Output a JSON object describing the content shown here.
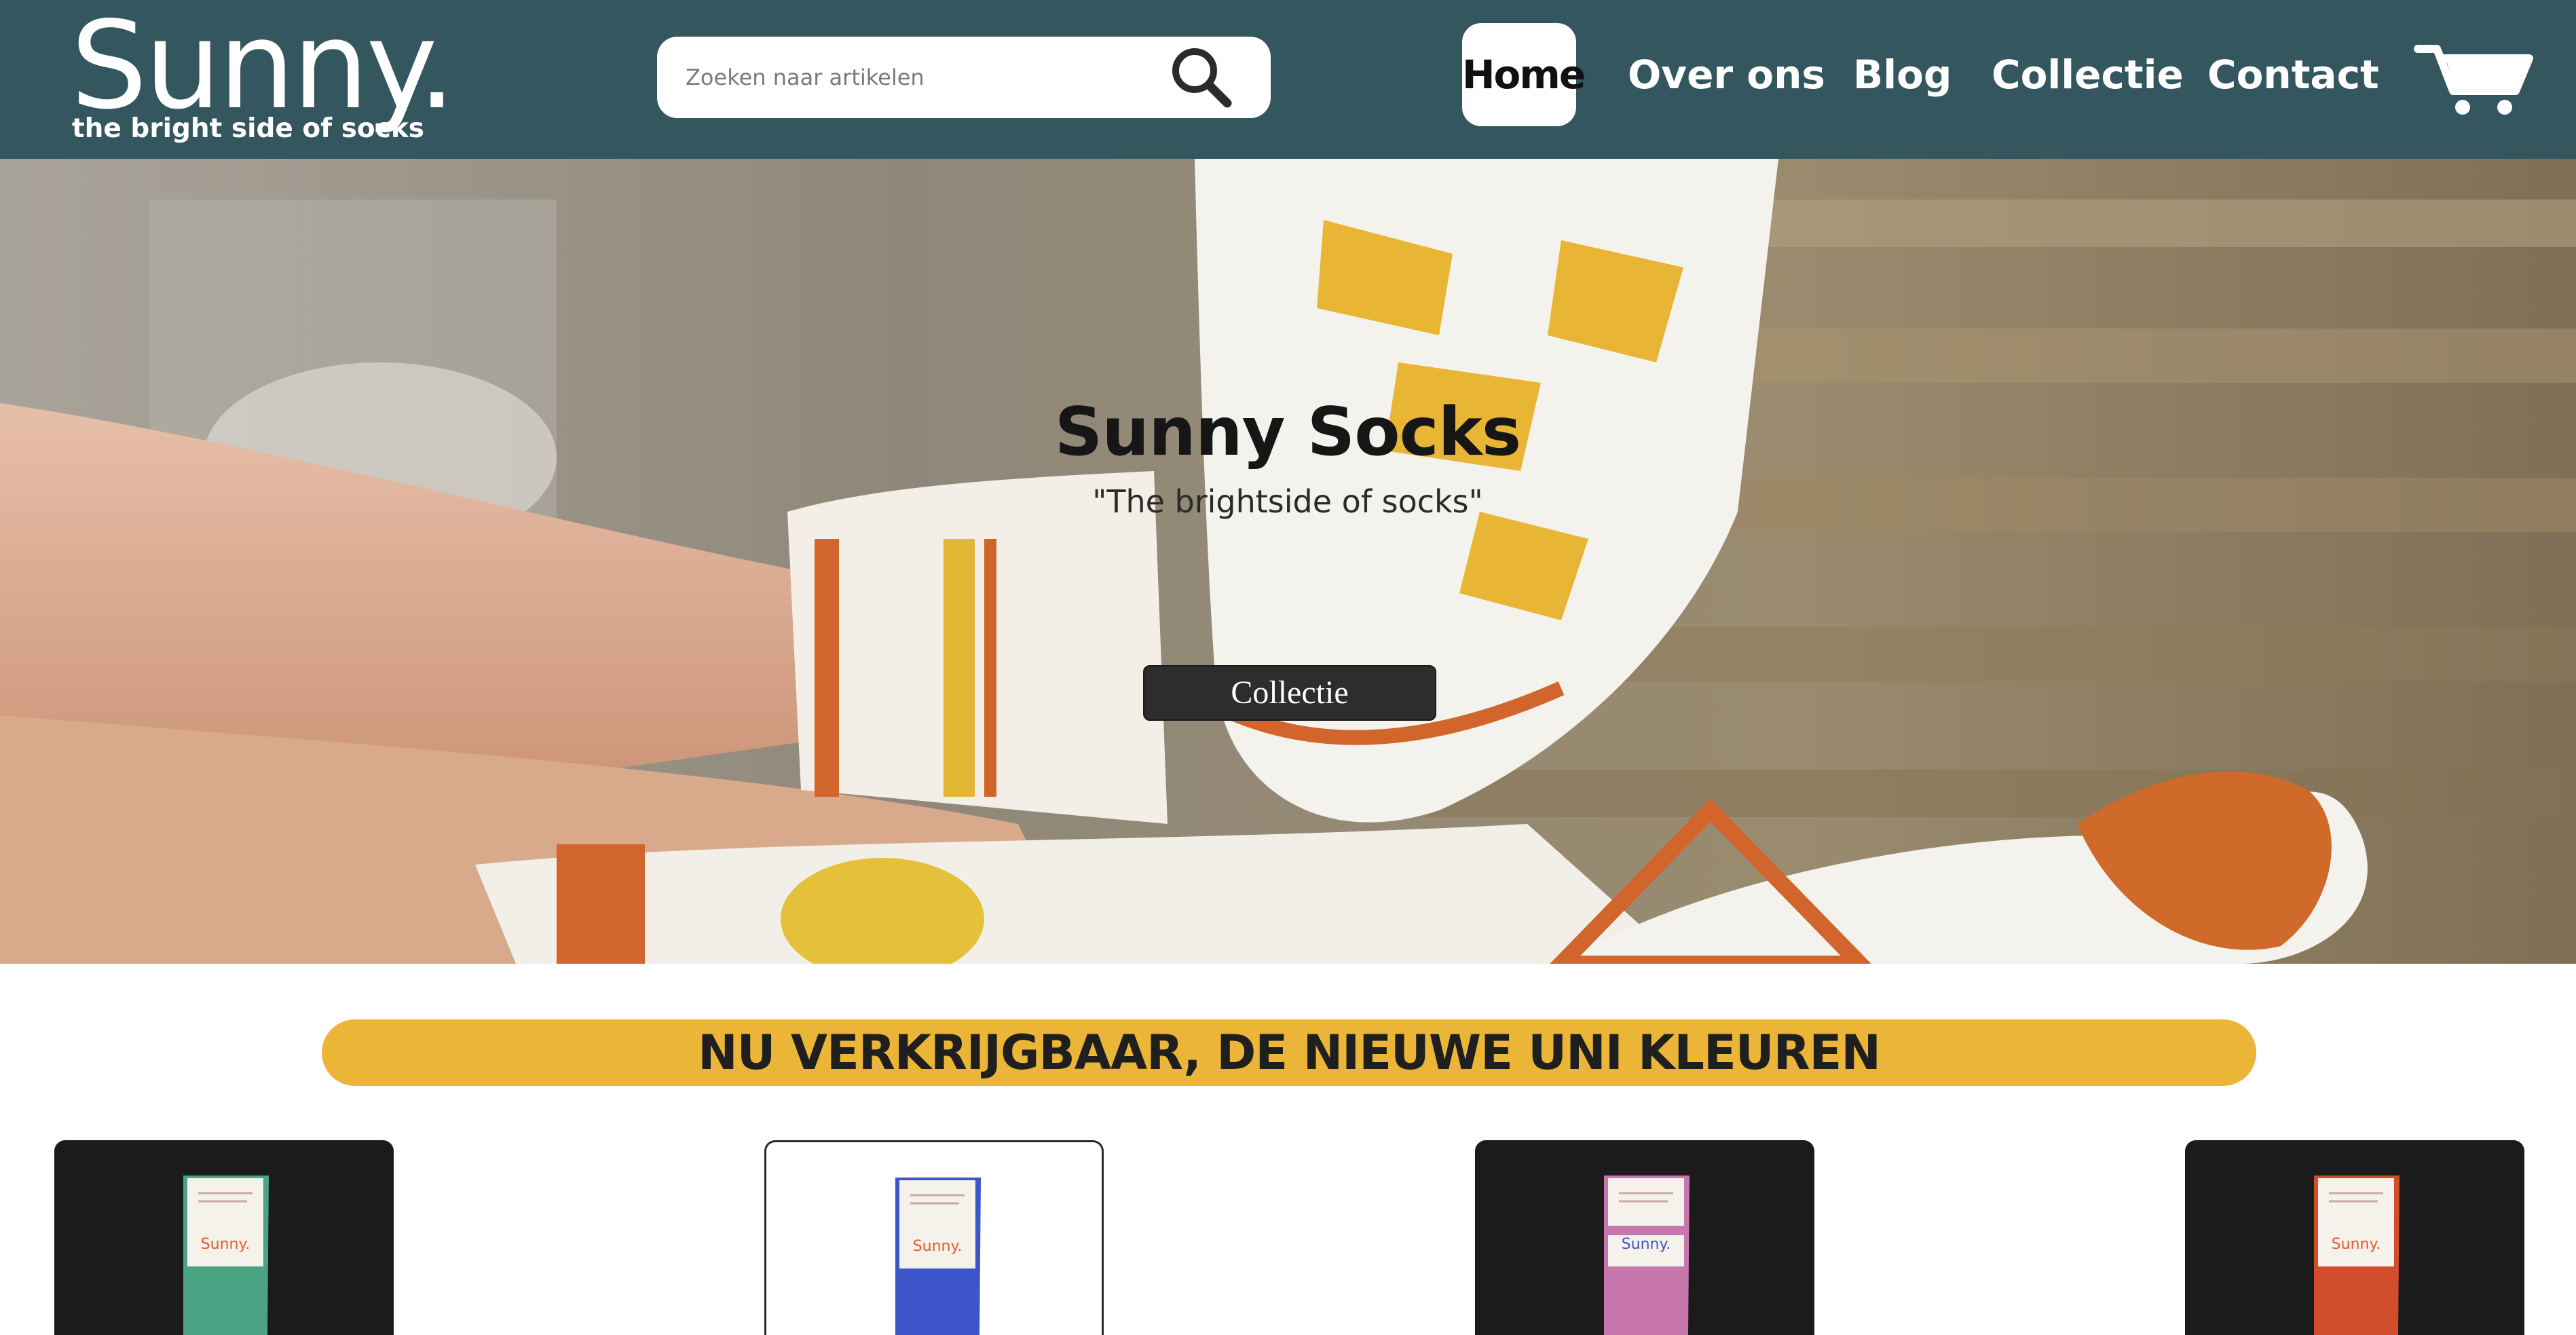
{
  "header": {
    "logo_text": "Sunny.",
    "logo_tagline": "the bright side of socks",
    "search": {
      "placeholder": "Zoeken naar artikelen",
      "value": ""
    },
    "nav": [
      {
        "label": "Home",
        "active": true
      },
      {
        "label": "Over ons",
        "active": false
      },
      {
        "label": "Blog",
        "active": false
      },
      {
        "label": "Collectie",
        "active": false
      },
      {
        "label": "Contact",
        "active": false
      }
    ],
    "cart_icon": "shopping-cart-icon",
    "search_icon": "magnifier-icon"
  },
  "hero": {
    "title": "Sunny Socks",
    "subtitle": "\"The brightside of socks\"",
    "button_label": "Collectie"
  },
  "banner": {
    "text": "NU VERKRIJGBAAR, DE NIEUWE UNI KLEUREN"
  },
  "products": [
    {
      "label": "Sunny.",
      "sock_color": "#4aa383",
      "card_bg": "dark"
    },
    {
      "label": "Sunny.",
      "sock_color": "#3c56c9",
      "card_bg": "light"
    },
    {
      "label": "Sunny.",
      "sock_color": "#c777ae",
      "card_bg": "dark"
    },
    {
      "label": "Sunny.",
      "sock_color": "#d24d2c",
      "card_bg": "dark"
    }
  ],
  "colors": {
    "header_bg": "#34575f",
    "banner_bg": "#ebb637",
    "button_bg": "#2d2d2d",
    "label_accent": "#e8582c"
  }
}
